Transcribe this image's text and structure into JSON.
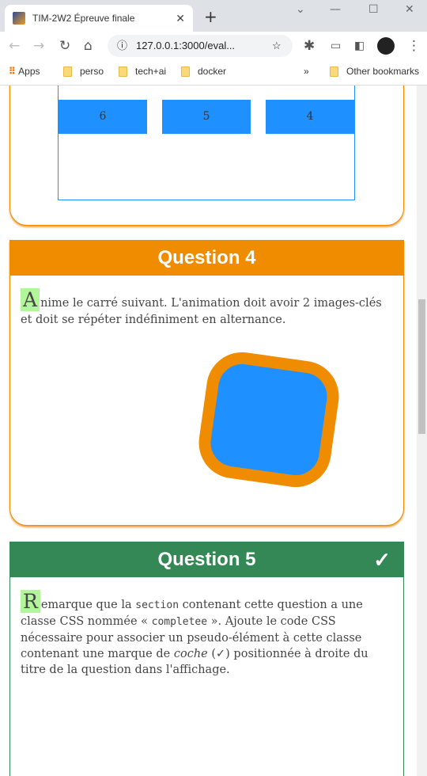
{
  "browser": {
    "tab_title": "TIM-2W2 Épreuve finale",
    "url": "127.0.0.1:3000/eval...",
    "bookmarks": [
      "Apps",
      "perso",
      "tech+ai",
      "docker"
    ],
    "other_bookmarks": "Other bookmarks",
    "more": "»"
  },
  "card_prev": {
    "boxes": [
      "6",
      "5",
      "4"
    ]
  },
  "q4": {
    "title": "Question 4",
    "drop": "A",
    "text": "nime le carré suivant. L'animation doit avoir 2 images-clés et doit se répéter indéfiniment en alternance.",
    "color": "#f08c00",
    "square_color": "#1e90ff"
  },
  "q5": {
    "title": "Question 5",
    "check": "✓",
    "drop": "R",
    "t1": "emarque que la ",
    "code1": "section",
    "t2": " contenant cette question a une classe CSS nommée « ",
    "code2": "completee",
    "t3": " ». Ajoute le code CSS nécessaire pour associer un pseudo-élément à cette classe contenant une marque de ",
    "em": "coche",
    "t4": " (✓) positionnée à droite du titre de la question dans l'affichage.",
    "color": "#338855"
  }
}
